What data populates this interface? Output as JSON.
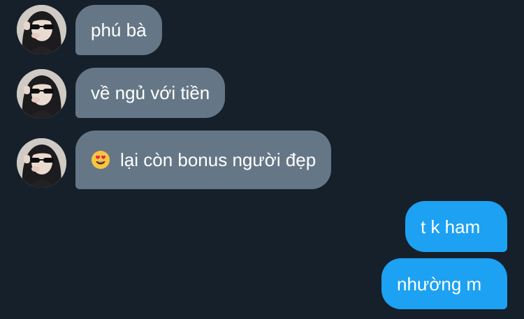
{
  "messages": {
    "incoming": [
      {
        "text": "phú bà",
        "emoji": ""
      },
      {
        "text": "về ngủ với tiền",
        "emoji": ""
      },
      {
        "text": "lại còn bonus người đẹp",
        "emoji": "heart-eyes-emoji"
      }
    ],
    "outgoing": [
      {
        "text": "t k ham"
      },
      {
        "text": "nhường m"
      }
    ]
  },
  "colors": {
    "background": "#15202b",
    "incoming_bubble": "#657786",
    "outgoing_bubble": "#1da1f2",
    "text": "#ffffff"
  }
}
